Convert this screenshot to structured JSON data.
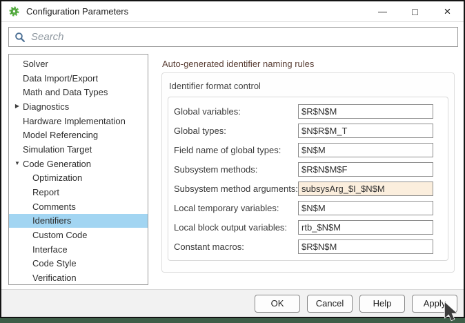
{
  "window": {
    "title": "Configuration Parameters",
    "controls": {
      "minimize": "—",
      "maximize": "□",
      "close": "×"
    }
  },
  "search": {
    "placeholder": "Search"
  },
  "sidebar": {
    "items": [
      {
        "label": "Solver",
        "level": 0
      },
      {
        "label": "Data Import/Export",
        "level": 0
      },
      {
        "label": "Math and Data Types",
        "level": 0
      },
      {
        "label": "Diagnostics",
        "level": 0,
        "arrow": "collapsed"
      },
      {
        "label": "Hardware Implementation",
        "level": 0
      },
      {
        "label": "Model Referencing",
        "level": 0
      },
      {
        "label": "Simulation Target",
        "level": 0
      },
      {
        "label": "Code Generation",
        "level": 0,
        "arrow": "expanded"
      },
      {
        "label": "Optimization",
        "level": 1
      },
      {
        "label": "Report",
        "level": 1
      },
      {
        "label": "Comments",
        "level": 1
      },
      {
        "label": "Identifiers",
        "level": 1,
        "selected": true
      },
      {
        "label": "Custom Code",
        "level": 1
      },
      {
        "label": "Interface",
        "level": 1
      },
      {
        "label": "Code Style",
        "level": 1
      },
      {
        "label": "Verification",
        "level": 1
      }
    ]
  },
  "main": {
    "heading": "Auto-generated identifier naming rules",
    "group": {
      "title": "Identifier format control",
      "fields": [
        {
          "label": "Global variables:",
          "value": "$R$N$M",
          "modified": false
        },
        {
          "label": "Global types:",
          "value": "$N$R$M_T",
          "modified": false
        },
        {
          "label": "Field name of global types:",
          "value": "$N$M",
          "modified": false
        },
        {
          "label": "Subsystem methods:",
          "value": "$R$N$M$F",
          "modified": false
        },
        {
          "label": "Subsystem method arguments:",
          "value": "subsysArg_$I_$N$M",
          "modified": true
        },
        {
          "label": "Local temporary variables:",
          "value": "$N$M",
          "modified": false
        },
        {
          "label": "Local block output variables:",
          "value": "rtb_$N$M",
          "modified": false
        },
        {
          "label": "Constant macros:",
          "value": "$R$N$M",
          "modified": false
        }
      ]
    }
  },
  "footer": {
    "ok": "OK",
    "cancel": "Cancel",
    "help": "Help",
    "apply": "Apply"
  },
  "icons": {
    "collapsed": "▶",
    "expanded": "▼"
  },
  "colors": {
    "selection": "#a2d5f2",
    "modified_field_bg": "#fbeedd",
    "heading_text": "#5a3f35",
    "gear_green": "#5cb744",
    "search_icon": "#4a6e93",
    "desktop_strip": "#3e5e48"
  }
}
